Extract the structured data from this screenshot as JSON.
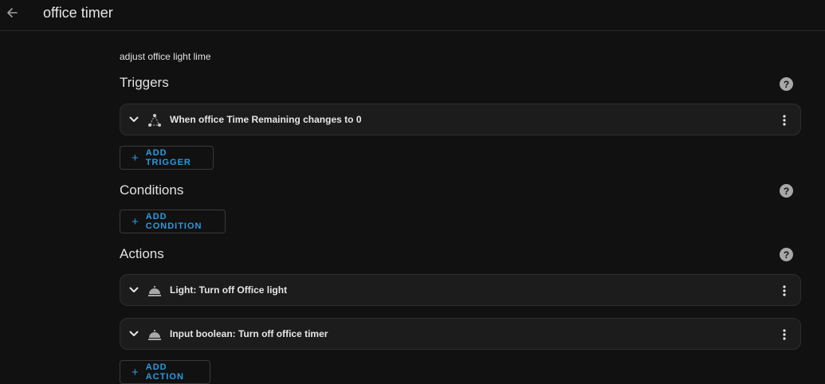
{
  "header": {
    "back_icon": "arrow-left-icon",
    "title": "office timer"
  },
  "description": "adjust office light lime",
  "triggers": {
    "title": "Triggers",
    "help_icon": "help-circle-icon",
    "items": [
      {
        "label": "When office Time Remaining changes to 0",
        "icon": "state-change-icon"
      }
    ],
    "add_label": "ADD TRIGGER"
  },
  "conditions": {
    "title": "Conditions",
    "help_icon": "help-circle-icon",
    "add_label": "ADD CONDITION"
  },
  "actions": {
    "title": "Actions",
    "help_icon": "help-circle-icon",
    "items": [
      {
        "label": "Light: Turn off Office light",
        "icon": "service-bell-icon"
      },
      {
        "label": "Input boolean: Turn off office timer",
        "icon": "service-bell-icon"
      }
    ],
    "add_label": "ADD ACTION"
  },
  "colors": {
    "background": "#111111",
    "card": "#1c1c1c",
    "accent": "#2a9ae0",
    "text": "#e1e1e1"
  }
}
